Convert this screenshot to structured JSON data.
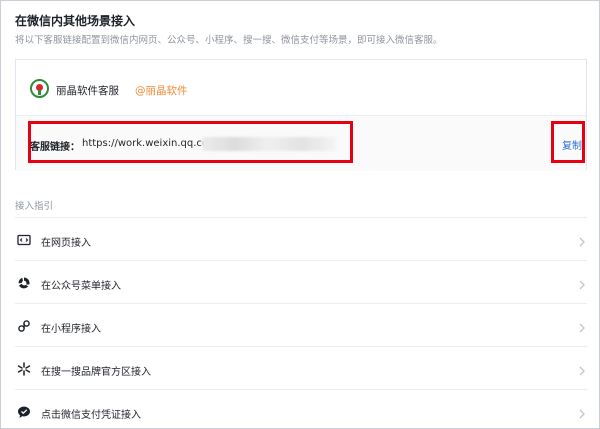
{
  "header": {
    "title": "在微信内其他场景接入",
    "subtitle": "将以下客服链接配置到微信内网页、公众号、小程序、搜一搜、微信支付等场景，即可接入微信客服。"
  },
  "account": {
    "name": "丽晶软件客服",
    "corp": "@丽晶软件"
  },
  "link": {
    "label": "客服链接：",
    "url": "https://work.weixin.qq.com",
    "copy_label": "复制"
  },
  "guide": {
    "title": "接入指引",
    "items": [
      {
        "label": "在网页接入",
        "icon": "webpage-icon"
      },
      {
        "label": "在公众号菜单接入",
        "icon": "official-account-icon"
      },
      {
        "label": "在小程序接入",
        "icon": "mini-program-icon"
      },
      {
        "label": "在搜一搜品牌官方区接入",
        "icon": "search-brand-icon"
      },
      {
        "label": "点击微信支付凭证接入",
        "icon": "wechat-pay-icon"
      }
    ]
  },
  "colors": {
    "highlight": "#e60012",
    "link": "#2a6fd6",
    "corp": "#f08b3a"
  }
}
